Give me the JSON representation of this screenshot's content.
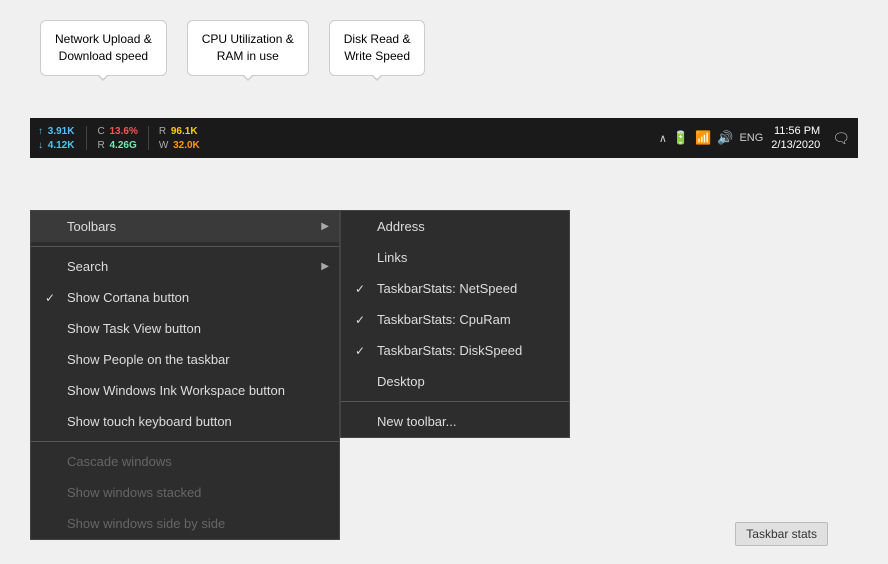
{
  "tooltips": [
    {
      "id": "network",
      "text": "Network Upload &\nDownload speed"
    },
    {
      "id": "cpu",
      "text": "CPU Utilization &\nRAM in use"
    },
    {
      "id": "disk",
      "text": "Disk Read &\nWrite Speed"
    }
  ],
  "taskbar": {
    "stats": {
      "upload_arrow": "↑",
      "upload_label": "",
      "upload_value": "3.91K",
      "download_arrow": "↓",
      "download_value": "4.12K",
      "cpu_label": "C",
      "cpu_value": "13.6%",
      "ram_label": "R",
      "ram_value": "4.26G",
      "read_label": "R",
      "read_value": "96.1K",
      "write_label": "W",
      "write_value": "32.0K"
    },
    "system_tray": {
      "lang": "ENG",
      "time": "11:56 PM",
      "date": "2/13/2020"
    }
  },
  "left_menu": {
    "items": [
      {
        "id": "toolbars",
        "label": "Toolbars",
        "has_arrow": true,
        "checked": false,
        "disabled": false
      },
      {
        "id": "search",
        "label": "Search",
        "has_arrow": true,
        "checked": false,
        "disabled": false
      },
      {
        "id": "cortana",
        "label": "Show Cortana button",
        "has_arrow": false,
        "checked": true,
        "disabled": false
      },
      {
        "id": "taskview",
        "label": "Show Task View button",
        "has_arrow": false,
        "checked": false,
        "disabled": false
      },
      {
        "id": "people",
        "label": "Show People on the taskbar",
        "has_arrow": false,
        "checked": false,
        "disabled": false
      },
      {
        "id": "ink",
        "label": "Show Windows Ink Workspace button",
        "has_arrow": false,
        "checked": false,
        "disabled": false
      },
      {
        "id": "keyboard",
        "label": "Show touch keyboard button",
        "has_arrow": false,
        "checked": false,
        "disabled": false
      },
      {
        "id": "cascade",
        "label": "Cascade windows",
        "has_arrow": false,
        "checked": false,
        "disabled": true
      },
      {
        "id": "stacked",
        "label": "Show windows stacked",
        "has_arrow": false,
        "checked": false,
        "disabled": true
      },
      {
        "id": "sidebyside",
        "label": "Show windows side by side",
        "has_arrow": false,
        "checked": false,
        "disabled": true
      }
    ]
  },
  "right_menu": {
    "items": [
      {
        "id": "address",
        "label": "Address",
        "checked": false
      },
      {
        "id": "links",
        "label": "Links",
        "checked": false
      },
      {
        "id": "netspeed",
        "label": "TaskbarStats: NetSpeed",
        "checked": true
      },
      {
        "id": "cpuram",
        "label": "TaskbarStats: CpuRam",
        "checked": true
      },
      {
        "id": "diskspeed",
        "label": "TaskbarStats: DiskSpeed",
        "checked": true
      },
      {
        "id": "desktop",
        "label": "Desktop",
        "checked": false
      },
      {
        "id": "newtoolbar",
        "label": "New toolbar...",
        "checked": false,
        "separator_before": true
      }
    ]
  },
  "taskbar_stats_label": "Taskbar stats"
}
